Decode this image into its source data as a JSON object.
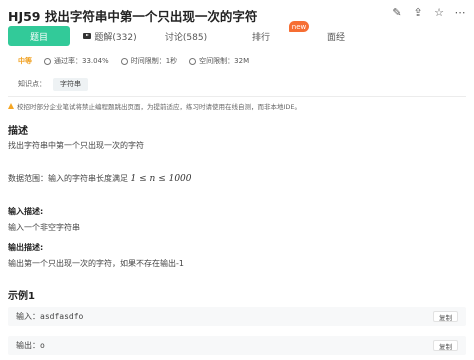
{
  "header": {
    "title": "HJ59  找出字符串中第一个只出现一次的字符",
    "icons": [
      "edit-icon",
      "share-icon",
      "star-icon",
      "more-icon"
    ]
  },
  "tabs": [
    {
      "label": "题目",
      "active": true
    },
    {
      "label": "题解(332)",
      "icon": "video-icon"
    },
    {
      "label": "讨论(585)"
    },
    {
      "label": "排行"
    },
    {
      "label": "面经",
      "badge": "new"
    }
  ],
  "meta": {
    "difficulty": "中等",
    "pass_rate": "通过率：33.04%",
    "time_limit": "时间限制：1秒",
    "space_limit": "空间限制：32M"
  },
  "knowledge": {
    "label": "知识点：",
    "tag": "字符串"
  },
  "warning": "校招时部分企业笔试将禁止编程题跳出页面，为提前适应，练习时请使用在线自测，而非本地IDE。",
  "description": {
    "heading": "描述",
    "text": "找出字符串中第一个只出现一次的字符",
    "range_prefix": "数据范围：输入的字符串长度满足",
    "range_math": "1 ≤ n ≤ 1000"
  },
  "input_desc": {
    "heading": "输入描述:",
    "text": "输入一个非空字符串"
  },
  "output_desc": {
    "heading": "输出描述:",
    "text": "输出第一个只出现一次的字符，如果不存在输出-1"
  },
  "example": {
    "heading": "示例1",
    "input_label": "输入：",
    "input_value": "asdfasdfo",
    "output_label": "输出：",
    "output_value": "o",
    "copy_label": "复制"
  },
  "colors": {
    "accent": "#32ca99",
    "badge": "#f66e33",
    "difficulty": "#f0a020",
    "warning": "#f5a623"
  }
}
